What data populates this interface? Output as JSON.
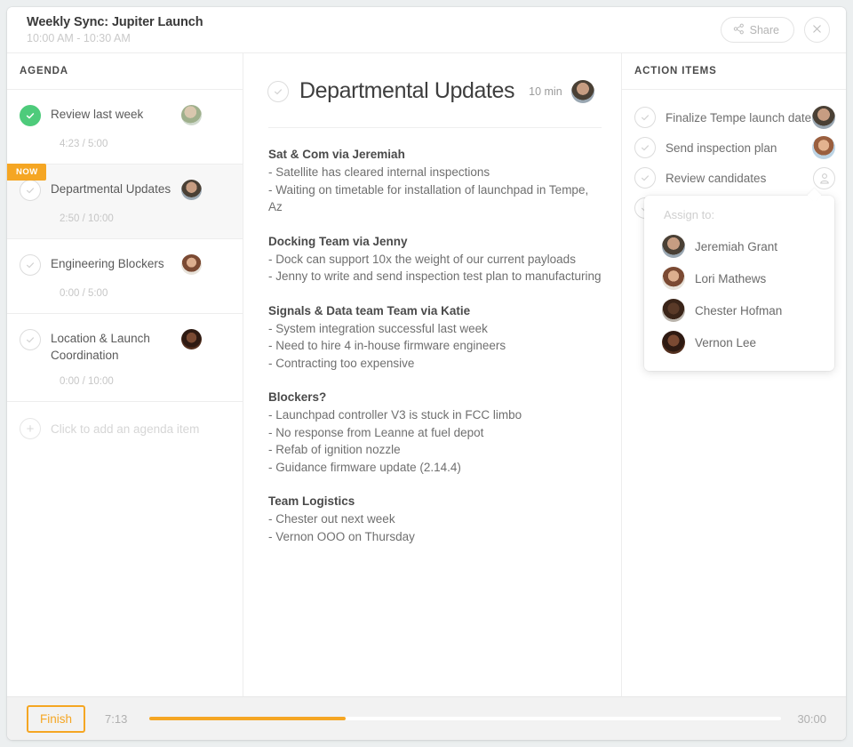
{
  "header": {
    "title": "Weekly Sync: Jupiter Launch",
    "time_range": "10:00 AM - 10:30 AM",
    "share_label": "Share",
    "share_icon": "share-icon",
    "close_icon": "close-icon"
  },
  "agenda": {
    "header": "AGENDA",
    "now_badge": "NOW",
    "add_label": "Click to add an agenda item",
    "add_icon": "plus-icon",
    "items": [
      {
        "label": "Review last week",
        "time": "4:23 / 5:00",
        "state": "done",
        "avatar": "av-a"
      },
      {
        "label": "Departmental Updates",
        "time": "2:50 / 10:00",
        "state": "active",
        "avatar": "av-b"
      },
      {
        "label": "Engineering Blockers",
        "time": "0:00 / 5:00",
        "state": "pending",
        "avatar": "av-c"
      },
      {
        "label": "Location & Launch Coordination",
        "time": "0:00 / 10:00",
        "state": "pending",
        "avatar": "av-d"
      }
    ]
  },
  "notes": {
    "title": "Departmental Updates",
    "duration": "10 min",
    "check_icon": "circle-check-icon",
    "avatar": "av-b",
    "blocks": [
      {
        "heading": "Sat & Com via Jeremiah",
        "lines": [
          "- Satellite has cleared internal inspections",
          "- Waiting on timetable for installation of launchpad in Tempe, Az"
        ]
      },
      {
        "heading": "Docking Team via Jenny",
        "lines": [
          "- Dock can support 10x the weight of our current payloads",
          "- Jenny to write and send inspection test plan to manufacturing"
        ]
      },
      {
        "heading": "Signals & Data team Team via Katie",
        "lines": [
          "- System integration successful last week",
          "- Need to hire 4 in-house firmware engineers",
          "- Contracting too expensive"
        ]
      },
      {
        "heading": "Blockers?",
        "lines": [
          "- Launchpad controller V3 is stuck in FCC limbo",
          "- No response from Leanne at fuel depot",
          "- Refab of ignition nozzle",
          "- Guidance firmware update (2.14.4)"
        ]
      },
      {
        "heading": "Team Logistics",
        "lines": [
          "- Chester out next week",
          "- Vernon OOO on Thursday"
        ]
      }
    ]
  },
  "action_items": {
    "header": "ACTION ITEMS",
    "items": [
      {
        "label": "Finalize Tempe launch date",
        "avatar": "av-b",
        "assigned": true
      },
      {
        "label": "Send inspection plan",
        "avatar": "av-e",
        "assigned": true
      },
      {
        "label": "Review candidates",
        "avatar": "person-placeholder-icon",
        "assigned": false
      }
    ],
    "assign_popup": {
      "title": "Assign to:",
      "people": [
        {
          "name": "Jeremiah Grant",
          "avatar": "av-b"
        },
        {
          "name": "Lori Mathews",
          "avatar": "av-c"
        },
        {
          "name": "Chester Hofman",
          "avatar": "av-f"
        },
        {
          "name": "Vernon Lee",
          "avatar": "av-d"
        }
      ]
    }
  },
  "footer": {
    "finish_label": "Finish",
    "elapsed": "7:13",
    "total": "30:00",
    "progress_percent": 31
  },
  "colors": {
    "accent_orange": "#f5a623",
    "done_green": "#4ecb7b",
    "text_dark": "#3e3e3e",
    "text_muted": "#9b9b9b"
  }
}
